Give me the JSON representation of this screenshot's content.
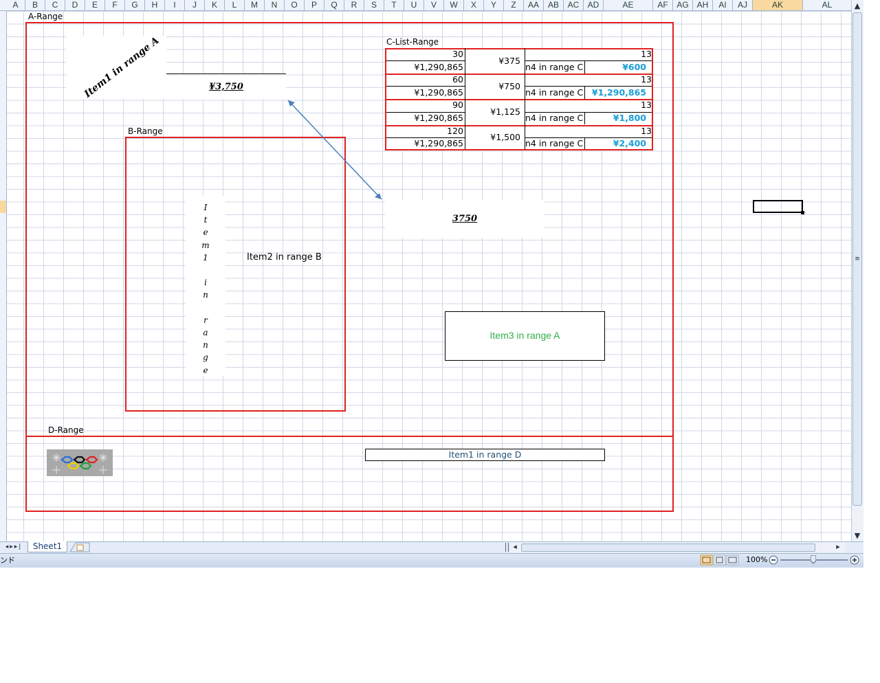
{
  "columns": [
    "A",
    "B",
    "C",
    "D",
    "E",
    "F",
    "G",
    "H",
    "I",
    "J",
    "K",
    "L",
    "M",
    "N",
    "O",
    "P",
    "Q",
    "R",
    "S",
    "T",
    "U",
    "V",
    "W",
    "X",
    "Y",
    "Z",
    "AA",
    "AB",
    "AC",
    "AD",
    "AE",
    "AF",
    "AG",
    "AH",
    "AI",
    "AJ",
    "AK",
    "AL"
  ],
  "selected_column": "AK",
  "ranges": {
    "a_label": "A-Range",
    "b_label": "B-Range",
    "c_label": "C-List-Range",
    "d_label": "D-Range"
  },
  "shapes": {
    "item1_a": "Item1 in range A",
    "price_a": "¥3,750",
    "item1_b_vertical": "Item1 in range",
    "item2_b": "Item2 in range B",
    "value_3750": "3750",
    "item3_a": "Item3 in range A",
    "item1_d": "Item1  in range D"
  },
  "clist": {
    "groups": [
      {
        "qty": "30",
        "total": "¥1,290,865",
        "price": "¥375",
        "count": "13",
        "label": "n4 in range C",
        "amount": "¥600"
      },
      {
        "qty": "60",
        "total": "¥1,290,865",
        "price": "¥750",
        "count": "13",
        "label": "n4 in range C",
        "amount": "¥1,290,865"
      },
      {
        "qty": "90",
        "total": "¥1,290,865",
        "price": "¥1,125",
        "count": "13",
        "label": "n4 in range C",
        "amount": "¥1,800"
      },
      {
        "qty": "120",
        "total": "¥1,290,865",
        "price": "¥1,500",
        "count": "13",
        "label": "n4 in range C",
        "amount": "¥2,400"
      }
    ]
  },
  "sheet_tab": "Sheet1",
  "status": {
    "left_text": "ンド",
    "zoom": "100%"
  },
  "colors": {
    "range_border": "#e02020",
    "accent_blue": "#1a9fd6",
    "item3_green": "#2fb04a",
    "d_item_text": "#1f4e79",
    "arrow": "#4a7ebb"
  }
}
